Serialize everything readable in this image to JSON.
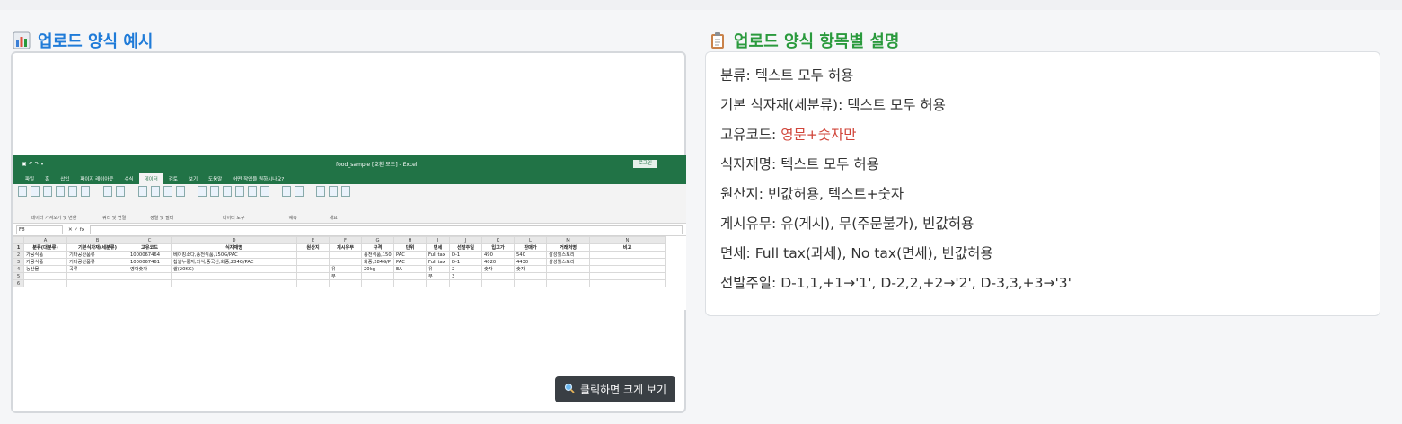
{
  "left_section": {
    "title": "업로드 양식 예시",
    "icon": "bar-chart-icon",
    "zoom_button_label": "클릭하면 크게 보기",
    "zoom_icon": "magnifier-icon"
  },
  "right_section": {
    "title": "업로드 양식 항목별 설명",
    "icon": "clipboard-icon",
    "items": [
      {
        "label": "분류:",
        "value": "텍스트 모두 허용"
      },
      {
        "label": "기본 식자재(세분류):",
        "value": "텍스트 모두 허용"
      },
      {
        "label": "고유코드:",
        "value": "영문+숫자만"
      },
      {
        "label": "식자재명:",
        "value": "텍스트 모두 허용"
      },
      {
        "label": "원산지:",
        "value": "빈값허용, 텍스트+숫자"
      },
      {
        "label": "게시유무:",
        "value": "유(게시), 무(주문불가), 빈값허용"
      },
      {
        "label": "면세:",
        "value": "Full tax(과세), No tax(면세), 빈값허용"
      },
      {
        "label": "선발주일:",
        "value": "D-1,1,+1→'1', D-2,2,+2→'2', D-3,3,+3→'3'"
      }
    ],
    "highlight_color": "#d0453a"
  },
  "excel": {
    "filename": "food_sample [호환 모드] - Excel",
    "login": "로그인",
    "tabs": [
      "파일",
      "홈",
      "삽입",
      "페이지 레이아웃",
      "수식",
      "데이터",
      "검토",
      "보기",
      "도움말",
      "어떤 작업을 원하시나요?"
    ],
    "active_tab": "데이터",
    "ribbon_groups": [
      "데이터 가져오기 및 변환",
      "쿼리 및 연결",
      "정렬 및 필터",
      "데이터 도구",
      "예측",
      "개요"
    ],
    "name_box": "F8",
    "columns": [
      "A",
      "B",
      "C",
      "D",
      "E",
      "F",
      "G",
      "H",
      "I",
      "J",
      "K",
      "L",
      "M",
      "N"
    ],
    "rows": [
      [
        "분류(대분류)",
        "기본식자재(세분류)",
        "고유코드",
        "식자재명",
        "원산지",
        "게시유무",
        "규격",
        "단위",
        "면세",
        "선발주일",
        "입고가",
        "판매가",
        "거래처명",
        "비고"
      ],
      [
        "가공식품",
        "기타공산품류",
        "1000067464",
        "베이킹소다,풍전식품,150G/PAC",
        "",
        "",
        "풍전식품,150",
        "PAC",
        "Full tax",
        "D-1",
        "490",
        "540",
        "삼성웰스토리",
        ""
      ],
      [
        "가공식품",
        "기타공산품류",
        "1000067461",
        "찹쌀누룽지,외식,중국산,화풍,284G/PAC",
        "",
        "",
        "화풍,284G/P",
        "PAC",
        "Full tax",
        "D-1",
        "4020",
        "4430",
        "삼성웰스토리",
        ""
      ],
      [
        "농산물",
        "곡류",
        "영어숫자",
        "쌀(20KG)",
        "",
        "유",
        "20kg",
        "EA",
        "유",
        "2",
        "숫자",
        "숫자",
        "",
        ""
      ],
      [
        "",
        "",
        "",
        "",
        "",
        "무",
        "",
        "",
        "무",
        "3",
        "",
        "",
        "",
        ""
      ]
    ]
  }
}
